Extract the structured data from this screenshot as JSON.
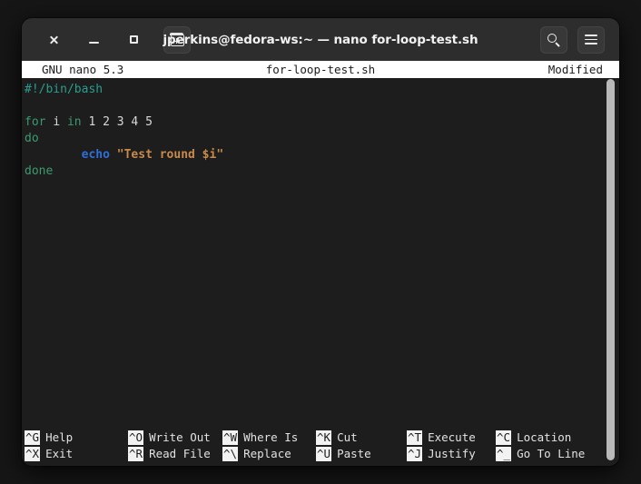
{
  "window": {
    "title": "jperkins@fedora-ws:~ — nano for-loop-test.sh",
    "controls": {
      "close": "close-icon",
      "minimize": "minimize-icon",
      "maximize": "maximize-icon",
      "new_tab": "new-tab-icon",
      "search": "search-icon",
      "menu": "hamburger-menu-icon"
    },
    "colors": {
      "page_background": "#161616",
      "titlebar_background": "#2d2d2d",
      "terminal_background": "#1d1d1d",
      "header_background": "#ffffff",
      "header_text": "#1b1b1b",
      "scrollbar_thumb": "#b9b9b9"
    }
  },
  "nano": {
    "header": {
      "version": "GNU nano 5.3",
      "filename": "for-loop-test.sh",
      "status": "Modified"
    },
    "editor": {
      "lines": [
        {
          "id": "line-1",
          "tokens": [
            {
              "text": "#!/bin/bash",
              "type": "comment"
            }
          ]
        },
        {
          "id": "line-2",
          "tokens": []
        },
        {
          "id": "line-3",
          "tokens": [
            {
              "text": "for",
              "type": "keyword"
            },
            {
              "text": " ",
              "type": "plain"
            },
            {
              "text": "i",
              "type": "plain"
            },
            {
              "text": " ",
              "type": "plain"
            },
            {
              "text": "in",
              "type": "keyword"
            },
            {
              "text": " 1 2 3 4 5",
              "type": "plain"
            }
          ]
        },
        {
          "id": "line-4",
          "tokens": [
            {
              "text": "do",
              "type": "keyword"
            }
          ]
        },
        {
          "id": "line-5",
          "tokens": [
            {
              "text": "        ",
              "type": "plain"
            },
            {
              "text": "echo",
              "type": "builtin"
            },
            {
              "text": " ",
              "type": "plain"
            },
            {
              "text": "\"Test round $i\"",
              "type": "string"
            }
          ]
        },
        {
          "id": "line-6",
          "tokens": [
            {
              "text": "done",
              "type": "keyword"
            }
          ]
        }
      ],
      "plain_text": "#!/bin/bash\n\nfor i in 1 2 3 4 5\ndo\n        echo \"Test round $i\"\ndone"
    },
    "shortcuts": {
      "row1": [
        {
          "key": "^G",
          "label": "Help"
        },
        {
          "key": "^O",
          "label": "Write Out"
        },
        {
          "key": "^W",
          "label": "Where Is"
        },
        {
          "key": "^K",
          "label": "Cut"
        },
        {
          "key": "^T",
          "label": "Execute"
        },
        {
          "key": "^C",
          "label": "Location"
        }
      ],
      "row2": [
        {
          "key": "^X",
          "label": "Exit"
        },
        {
          "key": "^R",
          "label": "Read File"
        },
        {
          "key": "^\\",
          "label": "Replace"
        },
        {
          "key": "^U",
          "label": "Paste"
        },
        {
          "key": "^J",
          "label": "Justify"
        },
        {
          "key": "^_",
          "label": "Go To Line"
        }
      ]
    }
  }
}
